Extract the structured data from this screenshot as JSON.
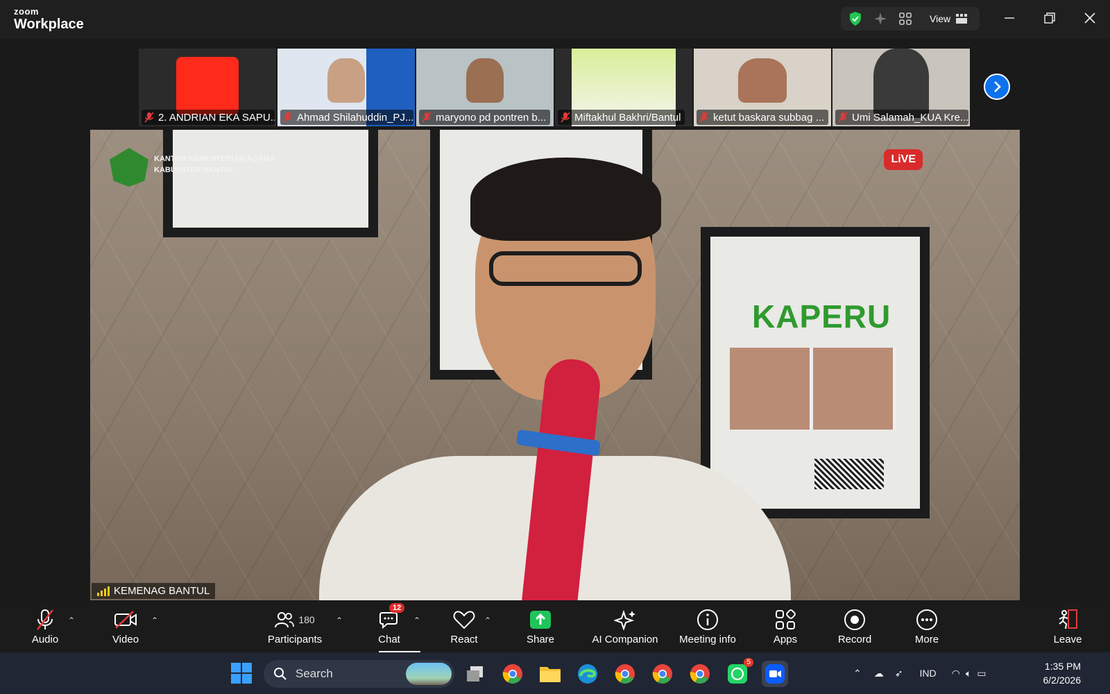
{
  "titlebar": {
    "brand_small": "zoom",
    "brand_big": "Workplace",
    "view_label": "View"
  },
  "thumbnails": [
    {
      "name": "2. ANDRIAN EKA SAPU...",
      "bg": "#ff2a1a"
    },
    {
      "name": "Ahmad Shilahuddin_PJ...",
      "bg": "#dfe6f0"
    },
    {
      "name": "maryono pd pontren b...",
      "bg": "#b9c2c4"
    },
    {
      "name": "Miftakhul Bakhri/Bantul",
      "bg": "#cfe6a0"
    },
    {
      "name": "ketut baskara subbag ...",
      "bg": "#d8d2c8"
    },
    {
      "name": "Umi Salamah_KUA Kre...",
      "bg": "#c9c4bc"
    }
  ],
  "main_video": {
    "office_line1": "KANTOR KEMENTERIAN AGAMA",
    "office_line2": "KABUPATEN BANTUL",
    "poster_title": "KAPERU",
    "live_label": "LiVE",
    "speaker": "KEMENAG BANTUL"
  },
  "toolbar": {
    "audio": "Audio",
    "video": "Video",
    "participants": "Participants",
    "participants_count": "180",
    "chat": "Chat",
    "chat_badge": "12",
    "react": "React",
    "share": "Share",
    "ai_companion": "AI Companion",
    "meeting_info": "Meeting info",
    "apps": "Apps",
    "record": "Record",
    "more": "More",
    "leave": "Leave"
  },
  "taskbar": {
    "search_placeholder": "Search",
    "whatsapp_badge": "5",
    "language": "IND",
    "time": "1:35 PM",
    "date": "6/2/2026"
  },
  "colors": {
    "accent": "#0e72ed",
    "share_green": "#1fc45a",
    "alert_red": "#e02b2b"
  }
}
